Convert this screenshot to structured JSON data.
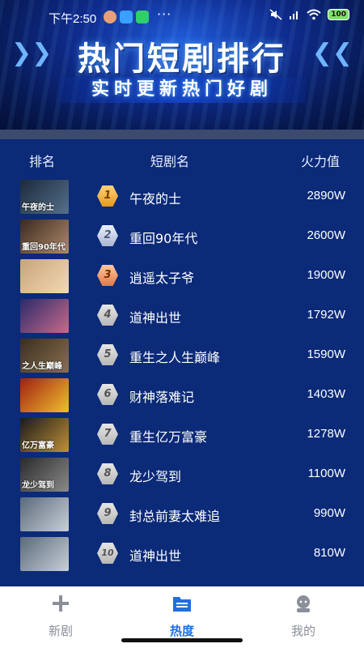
{
  "status_bar": {
    "time": "下午2:50",
    "battery": "100"
  },
  "banner": {
    "title": "热门短剧排行",
    "subtitle": "实时更新热门好剧"
  },
  "table": {
    "headers": {
      "rank": "排名",
      "name": "短剧名",
      "heat": "火力值"
    },
    "rows": [
      {
        "rank": "1",
        "name": "午夜的士",
        "heat": "2890W",
        "thumb_colors": [
          "#1b2a3a",
          "#56708c"
        ],
        "thumb_text": "午夜的士"
      },
      {
        "rank": "2",
        "name": "重回90年代",
        "heat": "2600W",
        "thumb_colors": [
          "#3a2a20",
          "#b08a6a"
        ],
        "thumb_text": "重回90年代"
      },
      {
        "rank": "3",
        "name": "逍遥太子爷",
        "heat": "1900W",
        "thumb_colors": [
          "#c9a47a",
          "#f1d9b4"
        ],
        "thumb_text": ""
      },
      {
        "rank": "4",
        "name": "道神出世",
        "heat": "1792W",
        "thumb_colors": [
          "#2a2a6a",
          "#c86a8a"
        ],
        "thumb_text": ""
      },
      {
        "rank": "5",
        "name": "重生之人生巅峰",
        "heat": "1590W",
        "thumb_colors": [
          "#3a2e20",
          "#8a7050"
        ],
        "thumb_text": "之人生巅峰"
      },
      {
        "rank": "6",
        "name": "财神落难记",
        "heat": "1403W",
        "thumb_colors": [
          "#a02010",
          "#f0c030"
        ],
        "thumb_text": ""
      },
      {
        "rank": "7",
        "name": "重生亿万富豪",
        "heat": "1278W",
        "thumb_colors": [
          "#1a1a1a",
          "#c0903a"
        ],
        "thumb_text": "亿万富豪"
      },
      {
        "rank": "8",
        "name": "龙少驾到",
        "heat": "1100W",
        "thumb_colors": [
          "#2a2a2a",
          "#8a8a8a"
        ],
        "thumb_text": "龙少驾到"
      },
      {
        "rank": "9",
        "name": "封总前妻太难追",
        "heat": "990W",
        "thumb_colors": [
          "#5a6a7a",
          "#c8d0d8"
        ],
        "thumb_text": ""
      },
      {
        "rank": "10",
        "name": "道神出世",
        "heat": "810W",
        "thumb_colors": [
          "#5a6a7a",
          "#c8d0d8"
        ],
        "thumb_text": ""
      }
    ]
  },
  "tab_bar": {
    "tabs": [
      {
        "label": "新剧",
        "icon": "plus-icon",
        "active": false
      },
      {
        "label": "热度",
        "icon": "folder-icon",
        "active": true
      },
      {
        "label": "我的",
        "icon": "user-icon",
        "active": false
      }
    ]
  },
  "colors": {
    "background": "#0b2a78",
    "accent": "#1f6fe0",
    "text": "#ffffff",
    "divider": "#3c4a6e"
  }
}
